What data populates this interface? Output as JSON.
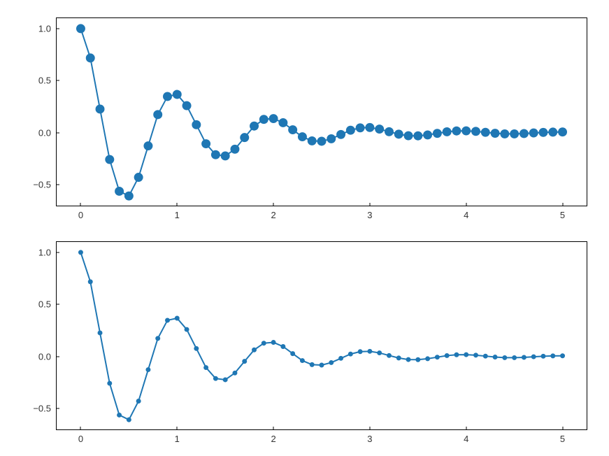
{
  "chart_data": [
    {
      "type": "line",
      "x": [
        0,
        0.1,
        0.2,
        0.3,
        0.4,
        0.5,
        0.6,
        0.7,
        0.8,
        0.9,
        1.0,
        1.1,
        1.2,
        1.3,
        1.4,
        1.5,
        1.6,
        1.7,
        1.8,
        1.9,
        2.0,
        2.1,
        2.2,
        2.3,
        2.4,
        2.5,
        2.6,
        2.7,
        2.8,
        2.9,
        3.0,
        3.1,
        3.2,
        3.3,
        3.4,
        3.5,
        3.6,
        3.7,
        3.8,
        3.9,
        4.0,
        4.1,
        4.2,
        4.3,
        4.4,
        4.5,
        4.6,
        4.7,
        4.8,
        4.9,
        5.0
      ],
      "values": [
        1.0,
        0.718,
        0.227,
        -0.257,
        -0.562,
        -0.607,
        -0.428,
        -0.126,
        0.174,
        0.348,
        0.368,
        0.26,
        0.077,
        -0.106,
        -0.211,
        -0.223,
        -0.158,
        -0.046,
        0.064,
        0.128,
        0.136,
        0.096,
        0.028,
        -0.039,
        -0.078,
        -0.082,
        -0.058,
        -0.017,
        0.024,
        0.047,
        0.05,
        0.035,
        0.01,
        -0.014,
        -0.029,
        -0.03,
        -0.021,
        -0.006,
        0.009,
        0.017,
        0.018,
        0.013,
        0.004,
        -0.005,
        -0.011,
        -0.011,
        -0.008,
        -0.002,
        0.003,
        0.006,
        0.007
      ],
      "xlim": [
        -0.25,
        5.25
      ],
      "ylim": [
        -0.7,
        1.1
      ],
      "xticks": [
        0,
        1,
        2,
        3,
        4,
        5
      ],
      "yticks": [
        -0.5,
        0.0,
        0.5,
        1.0
      ],
      "ytick_labels": [
        "−0.5",
        "0.0",
        "0.5",
        "1.0"
      ],
      "marker_radius": 6
    },
    {
      "type": "line",
      "x": [
        0,
        0.1,
        0.2,
        0.3,
        0.4,
        0.5,
        0.6,
        0.7,
        0.8,
        0.9,
        1.0,
        1.1,
        1.2,
        1.3,
        1.4,
        1.5,
        1.6,
        1.7,
        1.8,
        1.9,
        2.0,
        2.1,
        2.2,
        2.3,
        2.4,
        2.5,
        2.6,
        2.7,
        2.8,
        2.9,
        3.0,
        3.1,
        3.2,
        3.3,
        3.4,
        3.5,
        3.6,
        3.7,
        3.8,
        3.9,
        4.0,
        4.1,
        4.2,
        4.3,
        4.4,
        4.5,
        4.6,
        4.7,
        4.8,
        4.9,
        5.0
      ],
      "values": [
        1.0,
        0.718,
        0.227,
        -0.257,
        -0.562,
        -0.607,
        -0.428,
        -0.126,
        0.174,
        0.348,
        0.368,
        0.26,
        0.077,
        -0.106,
        -0.211,
        -0.223,
        -0.158,
        -0.046,
        0.064,
        0.128,
        0.136,
        0.096,
        0.028,
        -0.039,
        -0.078,
        -0.082,
        -0.058,
        -0.017,
        0.024,
        0.047,
        0.05,
        0.035,
        0.01,
        -0.014,
        -0.029,
        -0.03,
        -0.021,
        -0.006,
        0.009,
        0.017,
        0.018,
        0.013,
        0.004,
        -0.005,
        -0.011,
        -0.011,
        -0.008,
        -0.002,
        0.003,
        0.006,
        0.007
      ],
      "xlim": [
        -0.25,
        5.25
      ],
      "ylim": [
        -0.7,
        1.1
      ],
      "xticks": [
        0,
        1,
        2,
        3,
        4,
        5
      ],
      "yticks": [
        -0.5,
        0.0,
        0.5,
        1.0
      ],
      "ytick_labels": [
        "−0.5",
        "0.0",
        "0.5",
        "1.0"
      ],
      "marker_radius": 3
    }
  ]
}
